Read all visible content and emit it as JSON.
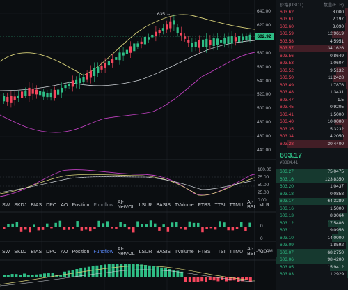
{
  "price_axis": {
    "labels": [
      "640.00",
      "620.00",
      "600.00",
      "580.00",
      "560.00",
      "540.00",
      "520.00",
      "500.00",
      "480.00",
      "460.00",
      "440.00"
    ],
    "current_price": "602.92",
    "high_marker": "635"
  },
  "indicator_axis": {
    "labels": [
      "100.00",
      "75.00",
      "50.00",
      "25.00",
      "0.00"
    ]
  },
  "volume_axis": {
    "zero_label": "0"
  },
  "fundflow_axis": {
    "labels": [
      "0",
      "-50.00M"
    ]
  },
  "indicator_tabs_1": [
    "SW",
    "SKDJ",
    "BIAS",
    "DPO",
    "AO",
    "Position",
    "Fundflow",
    "AI-NetVOL",
    "LSUR",
    "BASIS",
    "TVolume",
    "FTBS",
    "TTSI",
    "TTMU",
    "AI-BSI",
    "MLR"
  ],
  "indicator_tabs_2": [
    "SW",
    "SKDJ",
    "BIAS",
    "DPO",
    "AO",
    "Position",
    "Fundflow",
    "AI-NetVOL",
    "LSUR",
    "BASIS",
    "TVolume",
    "FTBS",
    "TTSI",
    "TTMU",
    "AI-BSI",
    "MLR"
  ],
  "orderbook": {
    "header_price": "价格(USDT)",
    "header_qty": "数量(ETH)",
    "asks": [
      {
        "price": "603.62",
        "qty": "3.000",
        "depth": 0.05
      },
      {
        "price": "603.61",
        "qty": "2.197",
        "depth": 0.03
      },
      {
        "price": "603.60",
        "qty": "3.090",
        "depth": 0.05
      },
      {
        "price": "603.59",
        "qty": "12.9619",
        "depth": 0.22
      },
      {
        "price": "603.58",
        "qty": "4.5951",
        "depth": 0.08
      },
      {
        "price": "603.57",
        "qty": "34.1626",
        "depth": 0.95
      },
      {
        "price": "603.56",
        "qty": "0.8649",
        "depth": 0.02
      },
      {
        "price": "603.53",
        "qty": "1.0607",
        "depth": 0.02
      },
      {
        "price": "603.52",
        "qty": "9.5132",
        "depth": 0.16
      },
      {
        "price": "603.50",
        "qty": "11.2428",
        "depth": 0.2
      },
      {
        "price": "603.49",
        "qty": "1.7876",
        "depth": 0.03
      },
      {
        "price": "603.48",
        "qty": "1.3431",
        "depth": 0.02
      },
      {
        "price": "603.47",
        "qty": "1.5",
        "depth": 0.02
      },
      {
        "price": "603.45",
        "qty": "0.9205",
        "depth": 0.02
      },
      {
        "price": "603.41",
        "qty": "1.5000",
        "depth": 0.02
      },
      {
        "price": "603.40",
        "qty": "10.0000",
        "depth": 0.18
      },
      {
        "price": "603.35",
        "qty": "5.3232",
        "depth": 0.09
      },
      {
        "price": "603.34",
        "qty": "4.2050",
        "depth": 0.07
      },
      {
        "price": "603.28",
        "qty": "30.4400",
        "depth": 0.85
      }
    ],
    "last_price": "603.17",
    "last_price_fiat": "¥3884.41",
    "bids": [
      {
        "price": "603.27",
        "qty": "75.0475",
        "depth": 1.0
      },
      {
        "price": "603.16",
        "qty": "123.8350",
        "depth": 1.0
      },
      {
        "price": "603.20",
        "qty": "1.0437",
        "depth": 0.02
      },
      {
        "price": "603.18",
        "qty": "0.0858",
        "depth": 0.01
      },
      {
        "price": "603.17",
        "qty": "64.3289",
        "depth": 0.95
      },
      {
        "price": "603.16",
        "qty": "1.5000",
        "depth": 0.02
      },
      {
        "price": "603.13",
        "qty": "8.3064",
        "depth": 0.12
      },
      {
        "price": "603.12",
        "qty": "17.5486",
        "depth": 0.28
      },
      {
        "price": "603.11",
        "qty": "9.0956",
        "depth": 0.14
      },
      {
        "price": "603.10",
        "qty": "14.0000",
        "depth": 0.22
      },
      {
        "price": "603.09",
        "qty": "1.8592",
        "depth": 0.03
      },
      {
        "price": "603.07",
        "qty": "68.2750",
        "depth": 0.98
      },
      {
        "price": "603.06",
        "qty": "98.4200",
        "depth": 1.0
      },
      {
        "price": "603.05",
        "qty": "15.9412",
        "depth": 0.25
      },
      {
        "price": "603.03",
        "qty": "1.2929",
        "depth": 0.02
      }
    ]
  },
  "colors": {
    "up": "#2ebd85",
    "down": "#f6465d",
    "bollinger": "#d9d27a",
    "mid": "#cfd3d8",
    "lower": "#c040c0"
  }
}
